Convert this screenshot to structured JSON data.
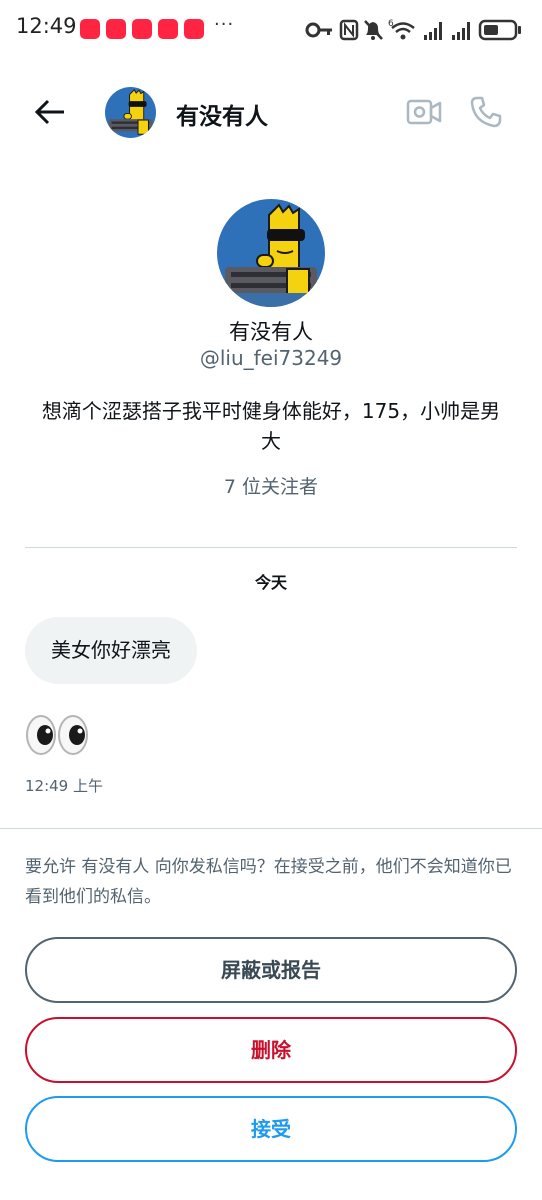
{
  "status_bar": {
    "time": "12:49",
    "more": "···",
    "badge_color": "#ff2442"
  },
  "header": {
    "title": "有没有人",
    "icons": [
      "back-arrow-icon",
      "video-camera-icon",
      "phone-icon"
    ]
  },
  "profile": {
    "name": "有没有人",
    "handle": "@liu_fei73249",
    "bio": "想滴个涩瑟搭子我平时健身体能好，175，小帅是男大",
    "followers": "7 位关注者"
  },
  "conversation": {
    "day_label": "今天",
    "messages": [
      {
        "text": "美女你好漂亮"
      },
      {
        "emoji": "👀",
        "time": "12:49 上午"
      }
    ]
  },
  "request": {
    "text": "要允许 有没有人 向你发私信吗？在接受之前，他们不会知道你已看到他们的私信。"
  },
  "actions": {
    "block_label": "屏蔽或报告",
    "delete_label": "删除",
    "accept_label": "接受"
  },
  "colors": {
    "accent": "#1d9bf0",
    "danger": "#c8102e",
    "muted": "#536471",
    "bubble": "#eff3f4"
  }
}
